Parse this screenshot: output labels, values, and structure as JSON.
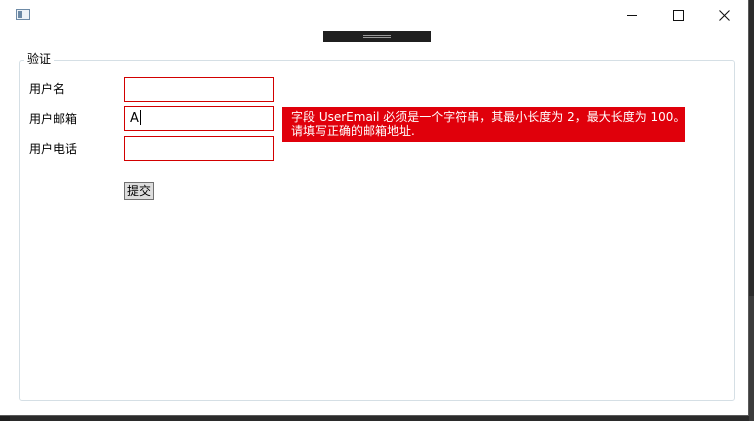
{
  "window": {
    "title": "",
    "controls": {
      "minimize_icon": "minimize-icon",
      "maximize_icon": "maximize-icon",
      "close_icon": "close-icon"
    }
  },
  "form": {
    "group_title": "验证",
    "fields": [
      {
        "label": "用户名",
        "value": ""
      },
      {
        "label": "用户邮箱",
        "value": "A"
      },
      {
        "label": "用户电话",
        "value": ""
      }
    ],
    "error_tooltip": {
      "line1": "字段 UserEmail 必须是一个字符串，其最小长度为 2，最大长度为 100。",
      "line2": "请填写正确的邮箱地址."
    },
    "submit_label": "提交"
  },
  "colors": {
    "error_border": "#d20000",
    "error_background": "#e0000b",
    "groupbox_border": "#d5dfe5"
  }
}
